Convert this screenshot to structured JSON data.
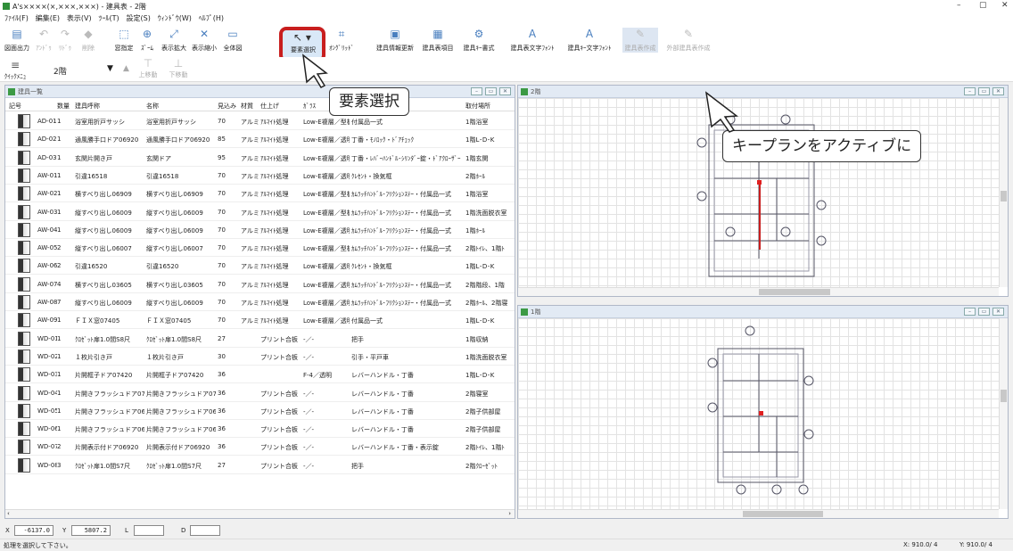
{
  "window": {
    "title": "A's××××(×,×××,×××) - 建具表 - 2階",
    "minimize": "–",
    "maximize": "▢",
    "close": "✕"
  },
  "menu": [
    "ﾌｧｲﾙ(F)",
    "編集(E)",
    "表示(V)",
    "ﾂｰﾙ(T)",
    "設定(S)",
    "ｳｨﾝﾄﾞｳ(W)",
    "ﾍﾙﾌﾟ(H)"
  ],
  "toolbar": {
    "items": [
      {
        "label": "図面出力",
        "icon": "print-icon",
        "enabled": true
      },
      {
        "label": "ｱﾝﾄﾞｩ",
        "icon": "undo-icon",
        "enabled": false
      },
      {
        "label": "ﾘﾄﾞｩ",
        "icon": "redo-icon",
        "enabled": false
      },
      {
        "label": "削除",
        "icon": "eraser-icon",
        "enabled": false
      },
      {
        "label": "窓指定",
        "icon": "window-select-icon",
        "enabled": true
      },
      {
        "label": "ｽﾞｰﾑ",
        "icon": "zoom-icon",
        "enabled": true
      },
      {
        "label": "表示拡大",
        "icon": "expand-icon",
        "enabled": true
      },
      {
        "label": "表示縮小",
        "icon": "shrink-icon",
        "enabled": true
      },
      {
        "label": "全体図",
        "icon": "fit-all-icon",
        "enabled": true
      },
      {
        "label": "要素選択",
        "icon": "pointer-icon",
        "enabled": true
      },
      {
        "label": "ｵﾝｸﾞﾘｯﾄﾞ",
        "icon": "grid-snap-icon",
        "enabled": true
      },
      {
        "label": "建具情報更新",
        "icon": "refresh-door-icon",
        "enabled": true
      },
      {
        "label": "建具表項目",
        "icon": "table-items-icon",
        "enabled": true
      },
      {
        "label": "建具ｷｰ書式",
        "icon": "key-format-icon",
        "enabled": true
      },
      {
        "label": "建具表文字ﾌｫﾝﾄ",
        "icon": "table-font-icon",
        "enabled": true
      },
      {
        "label": "建具ｷｰ文字ﾌｫﾝﾄ",
        "icon": "key-font-icon",
        "enabled": true
      },
      {
        "label": "建具表作成",
        "icon": "create-table-icon",
        "enabled": false
      },
      {
        "label": "外部建具表作成",
        "icon": "create-external-table-icon",
        "enabled": false
      }
    ],
    "quick_menu": "ｸｲｯｸﾒﾆｭｰ",
    "floor": "2階",
    "move_up": "上移動",
    "move_down": "下移動"
  },
  "callouts": {
    "select": "要素選択",
    "keyplan": "キープランをアクティブに"
  },
  "list_panel": {
    "title": "建具一覧",
    "columns": [
      "記号",
      "数量",
      "建具呼称",
      "名称",
      "見込み",
      "材質",
      "仕上げ",
      "ｶﾞﾗｽ",
      "",
      "取付場所"
    ],
    "rows": [
      [
        "AD-01",
        "1",
        "浴室用折戸サッシ",
        "浴室用折戸サッシ",
        "70",
        "アルミ",
        "ｱﾙﾏｲﾄ処理",
        "Low-E複層／型板",
        "付属品一式",
        "1階浴室"
      ],
      [
        "AD-02",
        "1",
        "通風勝手口ドア06920",
        "通風勝手口ドア06920",
        "85",
        "アルミ",
        "ｱﾙﾏｲﾄ処理",
        "Low-E複層／透明",
        "丁番・ﾓﾉﾛｯｸ・ﾄﾞｱﾁｪｯｸ",
        "1階L･D･K"
      ],
      [
        "AD-03",
        "1",
        "玄関片開き戸",
        "玄関ドア",
        "95",
        "アルミ",
        "ｱﾙﾏｲﾄ処理",
        "Low-E複層／透明",
        "丁番・ﾚﾊﾞｰﾊﾝﾄﾞﾙ･ｼﾘﾝﾀﾞｰ錠・ﾄﾞｱｸﾛｰｻﾞｰ",
        "1階玄関"
      ],
      [
        "AW-01",
        "1",
        "引違16518",
        "引違16518",
        "70",
        "アルミ",
        "ｱﾙﾏｲﾄ処理",
        "Low-E複層／透明",
        "ｸﾚｾﾝﾄ・換気框",
        "2階ﾎｰﾙ"
      ],
      [
        "AW-02",
        "1",
        "横すべり出し06909",
        "横すべり出し06909",
        "70",
        "アルミ",
        "ｱﾙﾏｲﾄ処理",
        "Low-E複層／型板",
        "ｶﾑﾗｯﾁﾊﾝﾄﾞﾙ･ﾌﾘｸｼｮﾝｽﾃｰ・付属品一式",
        "1階浴室"
      ],
      [
        "AW-03",
        "1",
        "縦すべり出し06009",
        "縦すべり出し06009",
        "70",
        "アルミ",
        "ｱﾙﾏｲﾄ処理",
        "Low-E複層／型板",
        "ｶﾑﾗｯﾁﾊﾝﾄﾞﾙ･ﾌﾘｸｼｮﾝｽﾃｰ・付属品一式",
        "1階洗面脱衣室"
      ],
      [
        "AW-04",
        "1",
        "縦すべり出し06009",
        "縦すべり出し06009",
        "70",
        "アルミ",
        "ｱﾙﾏｲﾄ処理",
        "Low-E複層／透明",
        "ｶﾑﾗｯﾁﾊﾝﾄﾞﾙ･ﾌﾘｸｼｮﾝｽﾃｰ・付属品一式",
        "1階ﾎｰﾙ"
      ],
      [
        "AW-05",
        "2",
        "縦すべり出し06007",
        "縦すべり出し06007",
        "70",
        "アルミ",
        "ｱﾙﾏｲﾄ処理",
        "Low-E複層／型板",
        "ｶﾑﾗｯﾁﾊﾝﾄﾞﾙ･ﾌﾘｸｼｮﾝｽﾃｰ・付属品一式",
        "2階ﾄｲﾚ、1階ﾄ"
      ],
      [
        "AW-06",
        "2",
        "引違16520",
        "引違16520",
        "70",
        "アルミ",
        "ｱﾙﾏｲﾄ処理",
        "Low-E複層／透明",
        "ｸﾚｾﾝﾄ・換気框",
        "1階L･D･K"
      ],
      [
        "AW-07",
        "4",
        "横すべり出し03605",
        "横すべり出し03605",
        "70",
        "アルミ",
        "ｱﾙﾏｲﾄ処理",
        "Low-E複層／透明",
        "ｶﾑﾗｯﾁﾊﾝﾄﾞﾙ･ﾌﾘｸｼｮﾝｽﾃｰ・付属品一式",
        "2階階段、1階"
      ],
      [
        "AW-08",
        "7",
        "縦すべり出し06009",
        "縦すべり出し06009",
        "70",
        "アルミ",
        "ｱﾙﾏｲﾄ処理",
        "Low-E複層／透明",
        "ｶﾑﾗｯﾁﾊﾝﾄﾞﾙ･ﾌﾘｸｼｮﾝｽﾃｰ・付属品一式",
        "2階ﾎｰﾙ、2階寝"
      ],
      [
        "AW-09",
        "1",
        "ＦＩＸ窓07405",
        "ＦＩＸ窓07405",
        "70",
        "アルミ",
        "ｱﾙﾏｲﾄ処理",
        "Low-E複層／透明",
        "付属品一式",
        "1階L･D･K"
      ],
      [
        "WD-01",
        "1",
        "ｸﾛｾﾞｯﾄ扉1.0間S8尺",
        "ｸﾛｾﾞｯﾄ扉1.0間S8尺",
        "27",
        "",
        "プリント合板",
        "-／-",
        "把手",
        "1階収納"
      ],
      [
        "WD-02",
        "1",
        "１枚片引き戸",
        "１枚片引き戸",
        "30",
        "",
        "プリント合板",
        "-／-",
        "引手・平戸車",
        "1階洗面脱衣室"
      ],
      [
        "WD-03",
        "1",
        "片開框子ドア07420",
        "片開框子ドア07420",
        "36",
        "",
        "",
        "F-4／透明",
        "レバーハンドル・丁番",
        "1階L･D･K"
      ],
      [
        "WD-04",
        "1",
        "片開きフラッシュドア07120",
        "片開きフラッシュドア07120",
        "36",
        "",
        "プリント合板",
        "-／-",
        "レバーハンドル・丁番",
        "2階寝室"
      ],
      [
        "WD-05",
        "1",
        "片開きフラッシュドア06920",
        "片開きフラッシュドア06920",
        "36",
        "",
        "プリント合板",
        "-／-",
        "レバーハンドル・丁番",
        "2階子供部屋"
      ],
      [
        "WD-06",
        "1",
        "片開きフラッシュドア06920",
        "片開きフラッシュドア06920",
        "36",
        "",
        "プリント合板",
        "-／-",
        "レバーハンドル・丁番",
        "2階子供部屋"
      ],
      [
        "WD-07",
        "2",
        "片開表示付ドア06920",
        "片開表示付ドア06920",
        "36",
        "",
        "プリント合板",
        "-／-",
        "レバーハンドル・丁番・表示錠",
        "2階ﾄｲﾚ、1階ﾄ"
      ],
      [
        "WD-08",
        "3",
        "ｸﾛｾﾞｯﾄ扉1.0間S7尺",
        "ｸﾛｾﾞｯﾄ扉1.0間S7尺",
        "27",
        "",
        "プリント合板",
        "-／-",
        "把手",
        "2階ｸﾛｰｾﾞｯﾄ"
      ]
    ]
  },
  "plan_top": {
    "title": "2階"
  },
  "plan_bottom": {
    "title": "1階"
  },
  "coords": {
    "x_label": "X",
    "x_value": "-6137.0",
    "y_label": "Y",
    "y_value": "5807.2",
    "l_label": "L",
    "l_value": "",
    "d_label": "D",
    "d_value": ""
  },
  "status": {
    "message": "処理を選択して下さい。",
    "x_scale": "X: 910.0/ 4",
    "y_scale": "Y: 910.0/ 4"
  }
}
